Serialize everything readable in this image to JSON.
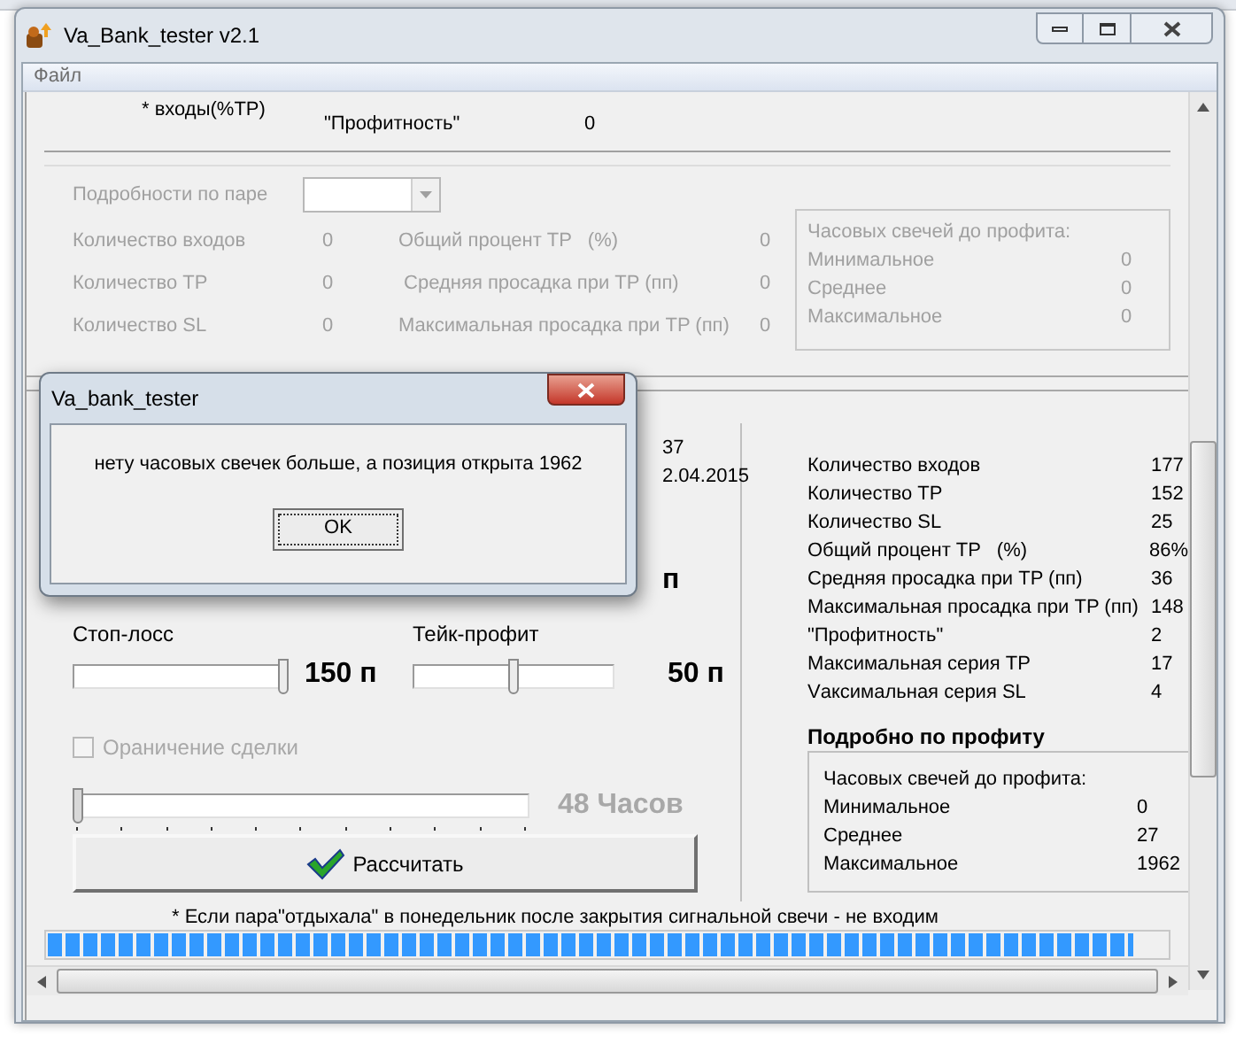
{
  "window": {
    "title": "Va_Bank_tester v2.1"
  },
  "menu": [
    {
      "label": "Файл",
      "disabled": true
    }
  ],
  "summary": {
    "note": "* входы(%TP)",
    "label": "\"Профитность\"",
    "value": "0"
  },
  "pair_details": {
    "disabled": true,
    "label": "Подробности по паре",
    "rows": [
      {
        "label": "Количество входов",
        "value": "0"
      },
      {
        "label": "Общий процент TP   (%)",
        "value": "0"
      },
      {
        "label": "Количество TP",
        "value": "0"
      },
      {
        "label": " Средняя просадка при TP (пп)",
        "value": "0"
      },
      {
        "label": "Количество SL",
        "value": "0"
      },
      {
        "label": "Максимальная просадка при TP (пп)",
        "value": "0"
      }
    ],
    "candles": {
      "title": "Часовых свечей до профита:",
      "rows": [
        {
          "label": "Минимальное",
          "value": "0"
        },
        {
          "label": "Среднее",
          "value": "0"
        },
        {
          "label": "Максимальное",
          "value": "0"
        }
      ]
    }
  },
  "partial_texts": [
    "37",
    "2.04.2015"
  ],
  "partial_reading": "п",
  "stop_loss": {
    "label": "Стоп-лосс",
    "level": 1,
    "reading": "150 п"
  },
  "take_profit": {
    "label": "Тейк-профит",
    "level": 0.5,
    "reading": "50 п"
  },
  "limit": {
    "label": "Ораничение сделки",
    "checked": false,
    "disabled": true,
    "level": 0,
    "reading": "48 Часов"
  },
  "calculate_button": "Рассчитать",
  "stats": [
    {
      "label": "Количество входов",
      "value": "177"
    },
    {
      "label": "Количество TP",
      "value": "152"
    },
    {
      "label": "Количество SL",
      "value": "25"
    },
    {
      "label": "Общий процент TP   (%)",
      "value": "86%"
    },
    {
      "label": "Средняя просадка при TP (пп)",
      "value": "36"
    },
    {
      "label": "Максимальная просадка при TP (пп)",
      "value": "148"
    },
    {
      "label": "\"Профитность\"",
      "value": "2"
    },
    {
      "label": "Максимальная серия TP",
      "value": "17"
    },
    {
      "label": "Vаксимальная серия SL",
      "value": "4"
    }
  ],
  "profit_details": {
    "title": "Подробно по профиту",
    "disabled": false,
    "candles": {
      "title": "Часовых свечей до профита:",
      "rows": [
        {
          "label": "Минимальное",
          "value": "0"
        },
        {
          "label": "Среднее",
          "value": "27"
        },
        {
          "label": "Максимальное",
          "value": "1962"
        }
      ]
    }
  },
  "footnote": "* Если пара\"отдыхала\" в понедельник после закрытия сигнальной свечи - не входим",
  "progress": {
    "level": 0.97
  },
  "dialog": {
    "title": "Va_bank_tester",
    "message": "нету часовых свечек больше, а позиция открыта 1962",
    "button": "OK"
  }
}
